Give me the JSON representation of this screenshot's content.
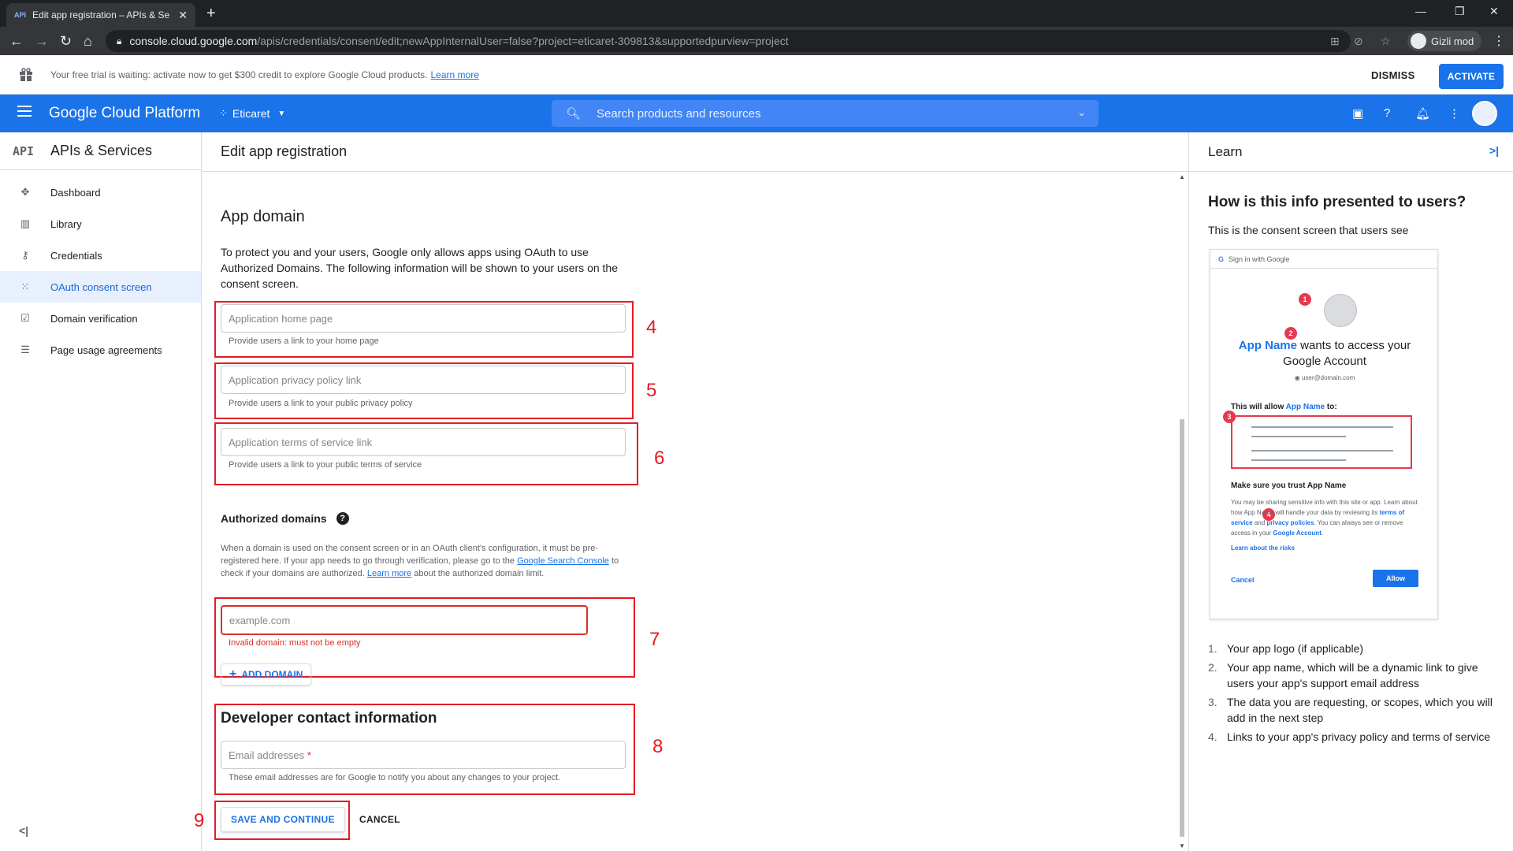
{
  "browser": {
    "tab_title": "Edit app registration – APIs & Se",
    "tab_favicon": "API",
    "url_host": "console.cloud.google.com",
    "url_path": "/apis/credentials/consent/edit;newAppInternalUser=false?project=eticaret-309813&supportedpurview=project",
    "profile_name": "Gizli mod"
  },
  "banner": {
    "text": "Your free trial is waiting: activate now to get $300 credit to explore Google Cloud products.",
    "learn_more": "Learn more",
    "dismiss": "DISMISS",
    "activate": "ACTIVATE"
  },
  "header": {
    "brand": "Google Cloud Platform",
    "project": "Eticaret",
    "search_placeholder": "Search products and resources"
  },
  "sidebar": {
    "api_badge": "API",
    "title": "APIs & Services",
    "items": [
      {
        "label": "Dashboard",
        "icon": "dashboard-icon"
      },
      {
        "label": "Library",
        "icon": "library-icon"
      },
      {
        "label": "Credentials",
        "icon": "key-icon"
      },
      {
        "label": "OAuth consent screen",
        "icon": "consent-grid-icon"
      },
      {
        "label": "Domain verification",
        "icon": "checkbox-icon"
      },
      {
        "label": "Page usage agreements",
        "icon": "settings-list-icon"
      }
    ],
    "active_index": 3
  },
  "main": {
    "page_title": "Edit app registration",
    "section_title": "App domain",
    "intro": "To protect you and your users, Google only allows apps using OAuth to use Authorized Domains. The following information will be shown to your users on the consent screen.",
    "fields": {
      "home_page": {
        "placeholder": "Application home page",
        "hint": "Provide users a link to your home page"
      },
      "privacy_policy": {
        "placeholder": "Application privacy policy link",
        "hint": "Provide users a link to your public privacy policy"
      },
      "terms_of_service": {
        "placeholder": "Application terms of service link",
        "hint": "Provide users a link to your public terms of service"
      }
    },
    "authorized_domains": {
      "title": "Authorized domains",
      "desc_1": "When a domain is used on the consent screen or in an OAuth client's configuration, it must be pre-registered here. If your app needs to go through verification, please go to the",
      "link_console": "Google Search Console",
      "desc_2": "to check if your domains are authorized.",
      "link_learn": "Learn more",
      "desc_3": "about the authorized domain limit.",
      "domain_placeholder": "example.com",
      "error": "Invalid domain: must not be empty",
      "add_domain": "ADD DOMAIN"
    },
    "developer": {
      "title": "Developer contact information",
      "email_placeholder": "Email addresses",
      "required_mark": "*",
      "hint": "These email addresses are for Google to notify you about any changes to your project."
    },
    "save_button": "SAVE AND CONTINUE",
    "cancel_button": "CANCEL",
    "annotations": [
      "4",
      "5",
      "6",
      "7",
      "8",
      "9"
    ]
  },
  "learn": {
    "title": "Learn",
    "heading": "How is this info presented to users?",
    "subtitle": "This is the consent screen that users see",
    "mock": {
      "header": "Sign in with Google",
      "app_name": "App Name",
      "wants": "wants to access your",
      "account": "Google Account",
      "email": "user@domain.com",
      "allow_prefix": "This will allow",
      "allow_suffix": "to:",
      "trust_title": "Make sure you trust App Name",
      "trust_desc_1": "You may be sharing sensitive info with this site or app. Learn about how App Name will handle your data by reviewing its",
      "terms_link": "terms of service",
      "and": "and",
      "privacy_link": "privacy policies",
      "trust_desc_2": ". You can always see or remove access in your",
      "account_link": "Google Account",
      "risks": "Learn about the risks",
      "cancel": "Cancel",
      "allow": "Allow",
      "markers": [
        "1",
        "2",
        "3",
        "4"
      ]
    },
    "list": [
      {
        "n": "1.",
        "text": "Your app logo (if applicable)"
      },
      {
        "n": "2.",
        "text": "Your app name, which will be a dynamic link to give users your app's support email address"
      },
      {
        "n": "3.",
        "text": "The data you are requesting, or scopes, which you will add in the next step"
      },
      {
        "n": "4.",
        "text": "Links to your app's privacy policy and terms of service"
      }
    ]
  },
  "colors": {
    "brand_blue": "#1a73e8",
    "annotation_red": "#e31c23",
    "error_red": "#d93025"
  }
}
